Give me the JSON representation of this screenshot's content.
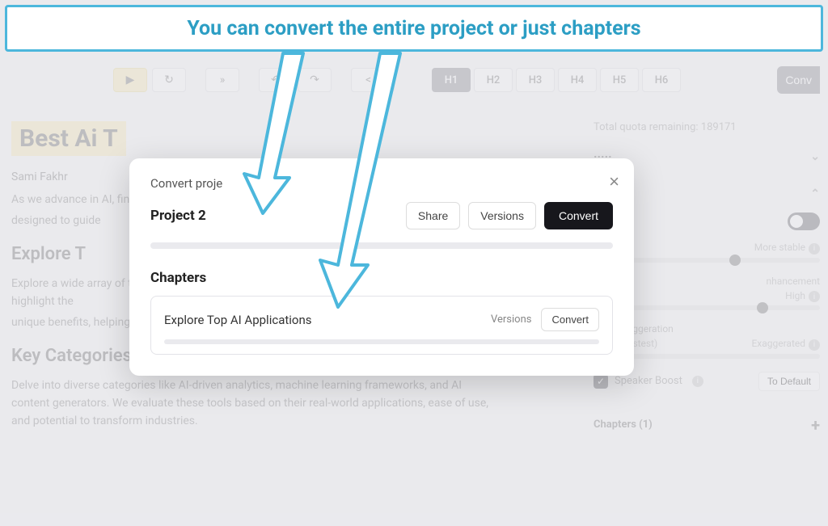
{
  "banner": "You can convert the entire project or just chapters",
  "toolbar": {
    "play": "▶",
    "refresh": "↻",
    "forward": "»",
    "undo": "↶",
    "redo": "↷",
    "code": "< >",
    "headings": [
      "H1",
      "H2",
      "H3",
      "H4",
      "H5",
      "H6"
    ],
    "convert": "Conv"
  },
  "doc": {
    "title": "Best Ai T",
    "author": "Sami Fakhr",
    "p1": "As we advance in AI, finding the best tools has become more important than ever. At Revi",
    "p1b": "designed to guide",
    "h2a": "Explore T",
    "p2": "Explore a wide array of top AI applications evaluated by researchers. Our in-depth reviews highlight the",
    "p2b": "unique benefits, helping you make well-informed choices tailored to your needs.",
    "h2b": "Key Categories of AI Tools",
    "p3": "Delve into diverse categories like AI-driven analytics, machine learning frameworks, and AI content generators. We evaluate these tools based on their real-world applications, ease of use, and potential to transform industries."
  },
  "rpanel": {
    "quota": "Total quota remaining: 189171",
    "settings_label": "ettings",
    "stability_right": "More stable",
    "enhance_label": "nhancement",
    "enhance_right": "High",
    "style_label": "Style Exaggeration",
    "style_left": "None (Fastest)",
    "style_right": "Exaggerated",
    "speaker": "Speaker Boost",
    "default": "To Default",
    "chapters": "Chapters (1)"
  },
  "modal": {
    "title": "Convert proje",
    "project": "Project 2",
    "share": "Share",
    "versions": "Versions",
    "convert": "Convert",
    "chapters_heading": "Chapters",
    "chapter_name": "Explore Top AI Applications",
    "chapter_versions": "Versions",
    "chapter_convert": "Convert"
  }
}
